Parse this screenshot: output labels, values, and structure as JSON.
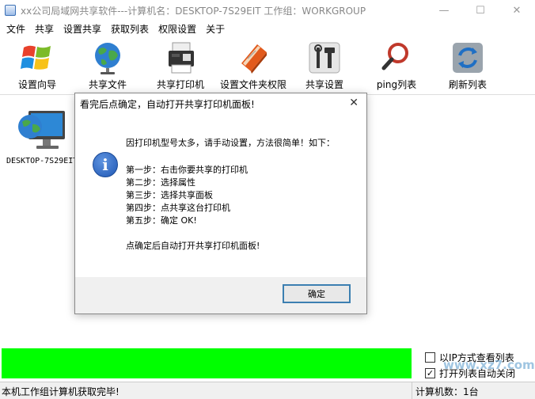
{
  "window": {
    "title": "xx公司局域网共享软件---计算机名：DESKTOP-7S29EIT   工作组：WORKGROUP",
    "minimize": "—",
    "maximize": "☐",
    "close": "✕"
  },
  "menu": [
    "文件",
    "共享",
    "设置共享",
    "获取列表",
    "权限设置",
    "关于"
  ],
  "toolbar": {
    "items": [
      {
        "label": "设置向导",
        "icon": "windows-logo-icon"
      },
      {
        "label": "共享文件",
        "icon": "globe-icon"
      },
      {
        "label": "共享打印机",
        "icon": "printer-icon"
      },
      {
        "label": "设置文件夹权限",
        "icon": "notebook-icon"
      },
      {
        "label": "共享设置",
        "icon": "tools-icon"
      },
      {
        "label": "ping列表",
        "icon": "magnifier-icon"
      },
      {
        "label": "刷新列表",
        "icon": "refresh-icon"
      }
    ]
  },
  "computers": [
    {
      "name": "DESKTOP-7S29EIT"
    }
  ],
  "dialog": {
    "title": "看完后点确定，自动打开共享打印机面板!",
    "close": "✕",
    "info_glyph": "i",
    "lines": [
      "因打印机型号太多，请手动设置，方法很简单！如下：",
      "第一步：右击你要共享的打印机",
      "第二步：选择属性",
      "第三步：选择共享面板",
      "第四步：点共享这台打印机",
      "第五步：确定  OK!",
      "点确定后自动打开共享打印机面板!"
    ],
    "ok_label": "确定"
  },
  "options": {
    "view_by_ip": {
      "label": "以IP方式查看列表",
      "checked": false
    },
    "auto_close": {
      "label": "打开列表自动关闭",
      "checked": true
    }
  },
  "progress": {
    "value": 1.0,
    "color": "#00ff00"
  },
  "status": {
    "message": "本机工作组计算机获取完毕!",
    "count": "计算机数：1台"
  },
  "watermark": "www.xz7.com"
}
